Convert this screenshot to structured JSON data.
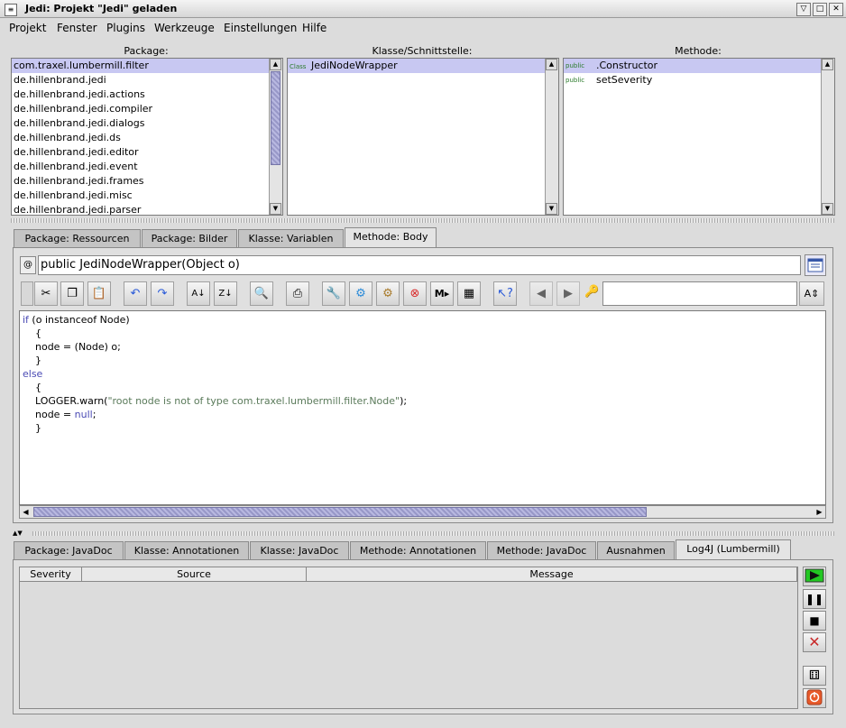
{
  "window": {
    "title": "Jedi: Projekt \"Jedi\" geladen"
  },
  "menu": [
    "Projekt",
    "Fenster",
    "Plugins",
    "Werkzeuge",
    "Einstellungen",
    "Hilfe"
  ],
  "panels": {
    "package": {
      "title": "Package:",
      "items": [
        "com.traxel.lumbermill.filter",
        "de.hillenbrand.jedi",
        "de.hillenbrand.jedi.actions",
        "de.hillenbrand.jedi.compiler",
        "de.hillenbrand.jedi.dialogs",
        "de.hillenbrand.jedi.ds",
        "de.hillenbrand.jedi.editor",
        "de.hillenbrand.jedi.event",
        "de.hillenbrand.jedi.frames",
        "de.hillenbrand.jedi.misc",
        "de.hillenbrand.jedi.parser"
      ]
    },
    "class": {
      "title": "Klasse/Schnittstelle:",
      "items": [
        {
          "tag": "Class",
          "name": "JediNodeWrapper"
        }
      ]
    },
    "method": {
      "title": "Methode:",
      "items": [
        {
          "tag": "public",
          "name": ".Constructor"
        },
        {
          "tag": "public",
          "name": "setSeverity"
        }
      ]
    }
  },
  "upper_tabs": [
    "Package: Ressourcen",
    "Package: Bilder",
    "Klasse: Variablen",
    "Methode: Body"
  ],
  "signature": {
    "at": "@",
    "text": "public JediNodeWrapper(Object o)"
  },
  "code": {
    "l1a": "if",
    "l1b": " (o instanceof Node)",
    "l2": "    {",
    "l3": "    node = (Node) o;",
    "l4": "    }",
    "l5": "else",
    "l6": "    {",
    "l7a": "    LOGGER.warn(",
    "l7b": "\"root node is not of type com.traxel.lumbermill.filter.Node\"",
    "l7c": ");",
    "l8a": "    node = ",
    "l8b": "null",
    "l8c": ";",
    "l9": "    }"
  },
  "lower_tabs": [
    "Package: JavaDoc",
    "Klasse: Annotationen",
    "Klasse: JavaDoc",
    "Methode: Annotationen",
    "Methode: JavaDoc",
    "Ausnahmen",
    "Log4J (Lumbermill)"
  ],
  "log_table": {
    "columns": [
      "Severity",
      "Source",
      "Message"
    ]
  },
  "colors": {
    "selection": "#c8c8f2",
    "keyword": "#4a4ab4",
    "string": "#5a7a5a",
    "play": "#22c822"
  }
}
